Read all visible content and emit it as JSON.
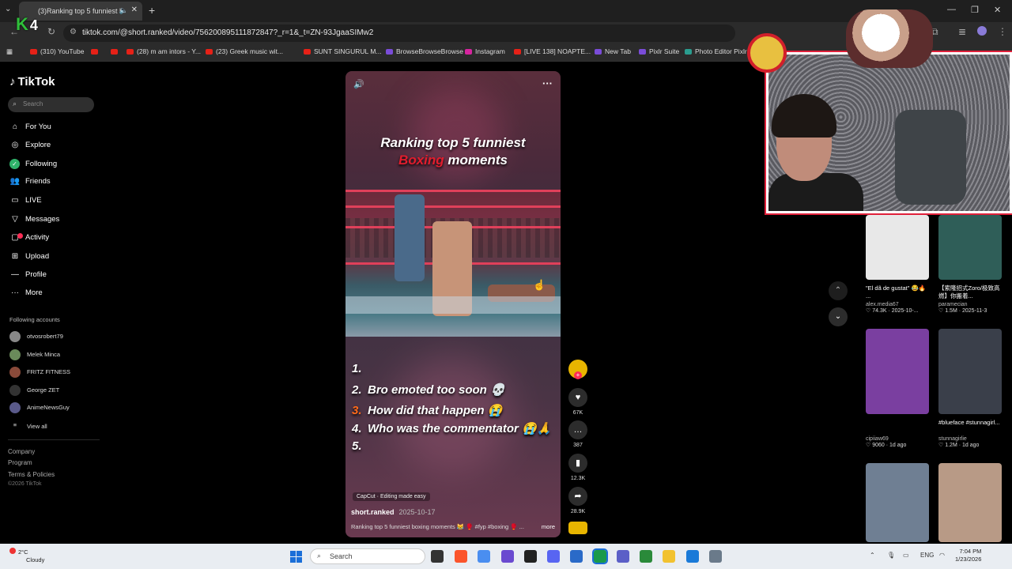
{
  "browser": {
    "tab_title": "(3)Ranking top 5 funniest b",
    "url": "tiktok.com/@short.ranked/video/756200895111872847?_r=1&_t=ZN-93JgaaSIMw2",
    "bookmarks": [
      "(310) YouTube",
      "(28) m am intors - Y...",
      "(23) Greek music wit...",
      "SUNT SINGURUL M...",
      "BrowseBrowseBrowse",
      "Instagram",
      "[LIVE 138] NOAPTE...",
      "New Tab",
      "Pixlr Suite",
      "Photo Editor Pixlr"
    ]
  },
  "overlay": {
    "channel_letter": "K",
    "channel_number": "4"
  },
  "tiktok": {
    "logo": "TikTok",
    "search_placeholder": "Search",
    "nav": [
      "For You",
      "Explore",
      "Following",
      "Friends",
      "LIVE",
      "Messages",
      "Activity",
      "Upload",
      "Profile",
      "More"
    ],
    "following_title": "Following accounts",
    "following": [
      "otvosrobert79",
      "Melek Minca",
      "FRITZ FITNESS",
      "George ZET",
      "AnimeNewsGuy",
      "View all"
    ],
    "footer": [
      "Company",
      "Program",
      "Terms & Policies",
      "©2026 TikTok"
    ]
  },
  "video": {
    "title_line1": "Ranking top 5 funniest",
    "title_red": "Boxing",
    "title_line2_rest": " moments",
    "list": [
      {
        "n": "1.",
        "text": ""
      },
      {
        "n": "2.",
        "text": "Bro emoted too soon 💀"
      },
      {
        "n": "3.",
        "text": "How did that happen 😭"
      },
      {
        "n": "4.",
        "text": "Who was the commentator 😭🙏"
      },
      {
        "n": "5.",
        "text": ""
      }
    ],
    "capcut": "CapCut · Editing made easy",
    "author": "short.ranked",
    "date": "2025-10-17",
    "caption": "Ranking top 5 funniest boxing moments 😹 🥊 #fyp #boxing 🥊 ...",
    "more": "more",
    "likes": "67K",
    "comments": "387",
    "saves": "12.3K",
    "shares": "28.9K"
  },
  "feed": [
    {
      "title": "\"El dã de gustat\" 😂🔥 ...",
      "user": "alex.media67",
      "stat": "♡ 74.3K · 2025-10-...",
      "color": "#e8e8e8"
    },
    {
      "title": "【索隆招式Zoro/极致高燃】你搬着...",
      "user": "paramecian",
      "stat": "♡ 1.5M · 2025-11-3",
      "color": "#2f5e58"
    },
    {
      "title": "",
      "user": "cipiiaw69",
      "stat": "♡ 9060 · 1d ago",
      "color": "#7a3fa0"
    },
    {
      "title": "#blueface #stunnagirl...",
      "user": "stunnagirlie",
      "stat": "♡ 1.2M · 1d ago",
      "color": "#3a3f4a"
    },
    {
      "title": "",
      "user": "",
      "stat": "",
      "color": "#6f7f93"
    },
    {
      "title": "",
      "user": "",
      "stat": "",
      "color": "#b89a86"
    }
  ],
  "taskbar": {
    "temp": "2°C",
    "weather": "Cloudy",
    "search": "Search",
    "lang": "ENG",
    "time": "7:04 PM",
    "date": "1/23/2026"
  }
}
